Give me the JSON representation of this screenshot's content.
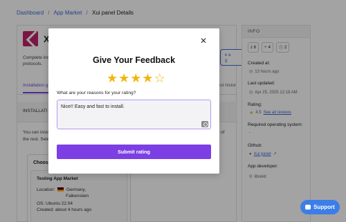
{
  "breadcrumb": {
    "items": [
      "Dashboard",
      "App Market"
    ],
    "current": "Xui panel Details"
  },
  "app": {
    "title_visible": "X",
    "description_line1": "Complete ins",
    "description_line2": "protocols.",
    "install_pill_line1": "e a",
    "install_pill_line2": "g"
  },
  "tabs": {
    "active_label": "Installation gu",
    "right_label": "test histor"
  },
  "installation": {
    "header": "INSTALLATI",
    "text_line1": "You can insta",
    "text_line2": "the rest. Sele",
    "text_right": "of"
  },
  "choose_server": {
    "title": "Choos",
    "server_name": "Testing App Market",
    "location_label": "Location:",
    "location_value_1": "Germany,",
    "location_value_2": "Falkenstein",
    "os": "OS: Ubuntu 22.04",
    "created": "Created: about 4 hours ago"
  },
  "sidebar": {
    "header": "INFO",
    "stats": [
      {
        "icon": "download-icon",
        "value": "6"
      },
      {
        "icon": "fork-icon",
        "value": "4"
      },
      {
        "icon": "info-circle-icon",
        "value": "2"
      }
    ],
    "created_label": "Created at:",
    "created_value": "13 hours ago",
    "updated_label": "Last updated:",
    "updated_value": "Apr 25, 2025 12:18 AM",
    "rating_label": "Rating:",
    "rating_value": "4.5",
    "see_reviews": "See all reviews",
    "os_label": "Required operating system:",
    "os_value": "-",
    "github_label": "Github:",
    "github_value": "Xui panel",
    "developer_label": "App developer:",
    "developer_value": "librekit"
  },
  "support": {
    "label": "Support",
    "color": "#3c7ee8"
  },
  "modal": {
    "title": "Give Your Feedback",
    "rating": 4,
    "max_rating": 5,
    "question": "What are your reasons for your rating?",
    "feedback_value": "Nice!! Easy and fast to install.",
    "submit_label": "Submit rating",
    "accent_color": "#7b3fe4"
  }
}
